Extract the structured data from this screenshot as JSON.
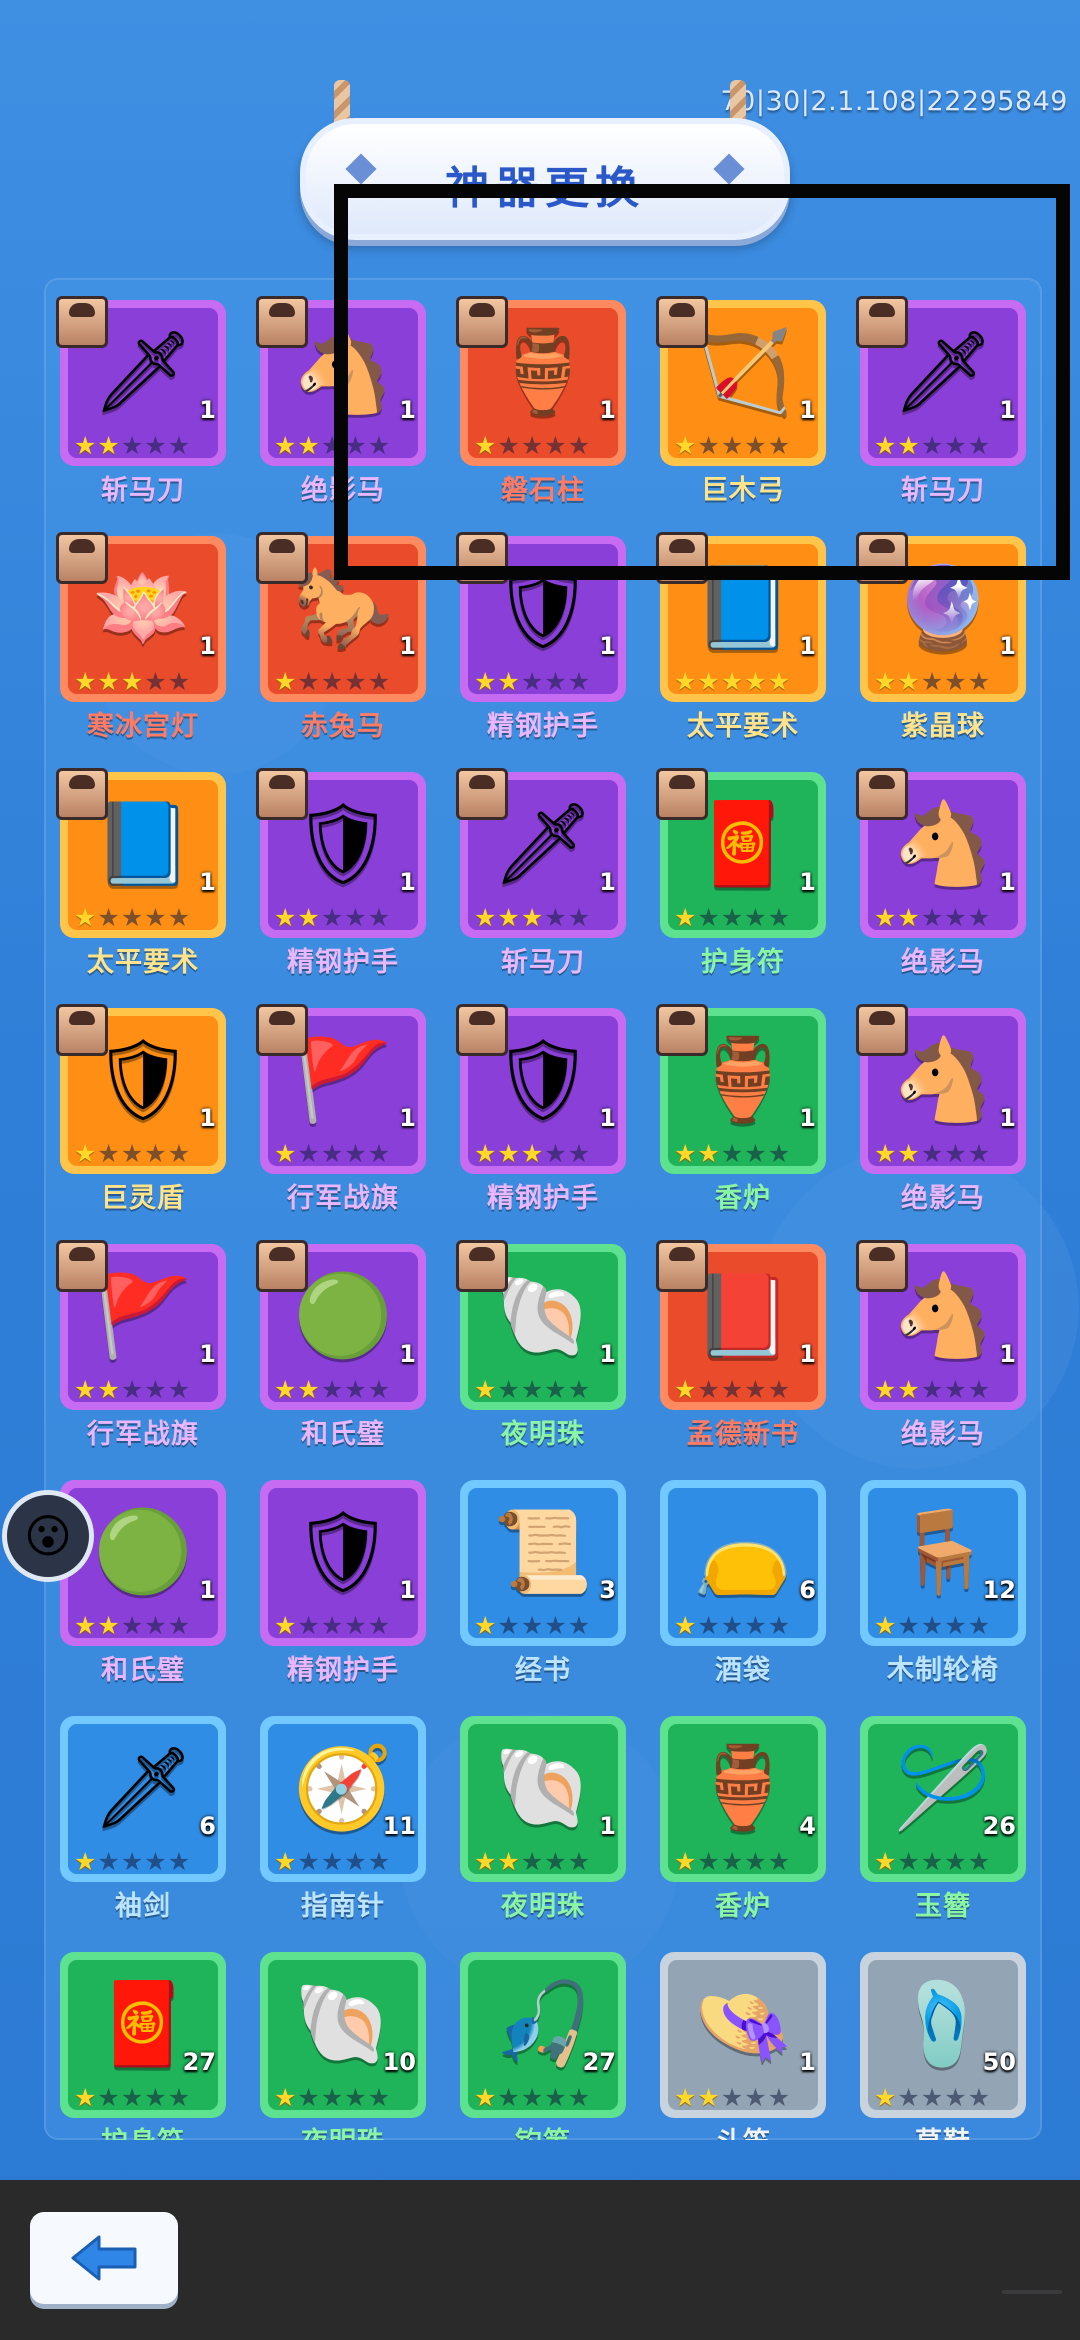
{
  "header": {
    "title": "神器更换",
    "version": "70|30|2.1.108|22295849"
  },
  "colors": {
    "purple": "#8a3fd9",
    "orange": "#ff8f14",
    "red": "#ea4b2b",
    "green": "#1fb45a",
    "blue": "#2f8de6",
    "gray": "#93a5b5",
    "star_on": "#ffd82a"
  },
  "items": [
    {
      "name": "斩马刀",
      "rarity": "purple",
      "stars": 2,
      "count": "1",
      "icon": "blade-icon",
      "glyph": "🗡",
      "portrait": true
    },
    {
      "name": "绝影马",
      "rarity": "purple",
      "stars": 2,
      "count": "1",
      "icon": "horse-armor-icon",
      "glyph": "🐴",
      "portrait": true
    },
    {
      "name": "磐石柱",
      "rarity": "red",
      "stars": 1,
      "count": "1",
      "icon": "stone-pillar-icon",
      "glyph": "🏺",
      "portrait": true
    },
    {
      "name": "巨木弓",
      "rarity": "orange",
      "stars": 1,
      "count": "1",
      "icon": "bow-icon",
      "glyph": "🏹",
      "portrait": true
    },
    {
      "name": "斩马刀",
      "rarity": "purple",
      "stars": 2,
      "count": "1",
      "icon": "blade-icon",
      "glyph": "🗡",
      "portrait": true
    },
    {
      "name": "寒冰宫灯",
      "rarity": "red",
      "stars": 3,
      "count": "1",
      "icon": "lotus-lamp-icon",
      "glyph": "🪷",
      "portrait": true
    },
    {
      "name": "赤兔马",
      "rarity": "red",
      "stars": 1,
      "count": "1",
      "icon": "red-horse-icon",
      "glyph": "🐎",
      "portrait": true
    },
    {
      "name": "精钢护手",
      "rarity": "purple",
      "stars": 2,
      "count": "1",
      "icon": "gauntlet-icon",
      "glyph": "🛡",
      "portrait": true
    },
    {
      "name": "太平要术",
      "rarity": "orange",
      "stars": 5,
      "count": "1",
      "icon": "book-icon",
      "glyph": "📘",
      "portrait": true
    },
    {
      "name": "紫晶球",
      "rarity": "orange",
      "stars": 2,
      "count": "1",
      "icon": "crystal-ball-icon",
      "glyph": "🔮",
      "portrait": true
    },
    {
      "name": "太平要术",
      "rarity": "orange",
      "stars": 1,
      "count": "1",
      "icon": "book-icon",
      "glyph": "📘",
      "portrait": true
    },
    {
      "name": "精钢护手",
      "rarity": "purple",
      "stars": 2,
      "count": "1",
      "icon": "gauntlet-icon",
      "glyph": "🛡",
      "portrait": true
    },
    {
      "name": "斩马刀",
      "rarity": "purple",
      "stars": 3,
      "count": "1",
      "icon": "blade-icon",
      "glyph": "🗡",
      "portrait": true
    },
    {
      "name": "护身符",
      "rarity": "green",
      "stars": 1,
      "count": "1",
      "icon": "amulet-icon",
      "glyph": "🧧",
      "portrait": true
    },
    {
      "name": "绝影马",
      "rarity": "purple",
      "stars": 2,
      "count": "1",
      "icon": "horse-armor-icon",
      "glyph": "🐴",
      "portrait": true
    },
    {
      "name": "巨灵盾",
      "rarity": "orange",
      "stars": 1,
      "count": "1",
      "icon": "shield-icon",
      "glyph": "🛡",
      "portrait": true
    },
    {
      "name": "行军战旗",
      "rarity": "purple",
      "stars": 1,
      "count": "1",
      "icon": "war-banner-icon",
      "glyph": "🚩",
      "portrait": true
    },
    {
      "name": "精钢护手",
      "rarity": "purple",
      "stars": 3,
      "count": "1",
      "icon": "gauntlet-icon",
      "glyph": "🛡",
      "portrait": true
    },
    {
      "name": "香炉",
      "rarity": "green",
      "stars": 2,
      "count": "1",
      "icon": "incense-burner-icon",
      "glyph": "🏺",
      "portrait": true
    },
    {
      "name": "绝影马",
      "rarity": "purple",
      "stars": 2,
      "count": "1",
      "icon": "horse-armor-icon",
      "glyph": "🐴",
      "portrait": true
    },
    {
      "name": "行军战旗",
      "rarity": "purple",
      "stars": 2,
      "count": "1",
      "icon": "war-banner-icon",
      "glyph": "🚩",
      "portrait": true
    },
    {
      "name": "和氏璧",
      "rarity": "purple",
      "stars": 2,
      "count": "1",
      "icon": "jade-disc-icon",
      "glyph": "🟢",
      "portrait": true
    },
    {
      "name": "夜明珠",
      "rarity": "green",
      "stars": 1,
      "count": "1",
      "icon": "pearl-shell-icon",
      "glyph": "🐚",
      "portrait": true
    },
    {
      "name": "孟德新书",
      "rarity": "red",
      "stars": 1,
      "count": "1",
      "icon": "military-book-icon",
      "glyph": "📕",
      "portrait": true
    },
    {
      "name": "绝影马",
      "rarity": "purple",
      "stars": 2,
      "count": "1",
      "icon": "horse-armor-icon",
      "glyph": "🐴",
      "portrait": true
    },
    {
      "name": "和氏璧",
      "rarity": "purple",
      "stars": 2,
      "count": "1",
      "icon": "jade-disc-icon",
      "glyph": "🟢",
      "portrait": false
    },
    {
      "name": "精钢护手",
      "rarity": "purple",
      "stars": 1,
      "count": "1",
      "icon": "gauntlet-icon",
      "glyph": "🛡",
      "portrait": false
    },
    {
      "name": "经书",
      "rarity": "blue",
      "stars": 1,
      "count": "3",
      "icon": "scroll-icon",
      "glyph": "📜",
      "portrait": false
    },
    {
      "name": "酒袋",
      "rarity": "blue",
      "stars": 1,
      "count": "6",
      "icon": "wine-bag-icon",
      "glyph": "👝",
      "portrait": false
    },
    {
      "name": "木制轮椅",
      "rarity": "blue",
      "stars": 1,
      "count": "12",
      "icon": "wooden-wheelchair-icon",
      "glyph": "🪑",
      "portrait": false
    },
    {
      "name": "袖剑",
      "rarity": "blue",
      "stars": 1,
      "count": "6",
      "icon": "sleeve-sword-icon",
      "glyph": "🗡",
      "portrait": false
    },
    {
      "name": "指南针",
      "rarity": "blue",
      "stars": 1,
      "count": "11",
      "icon": "compass-map-icon",
      "glyph": "🧭",
      "portrait": false
    },
    {
      "name": "夜明珠",
      "rarity": "green",
      "stars": 2,
      "count": "1",
      "icon": "pearl-shell-icon",
      "glyph": "🐚",
      "portrait": false
    },
    {
      "name": "香炉",
      "rarity": "green",
      "stars": 1,
      "count": "4",
      "icon": "incense-burner-icon",
      "glyph": "🏺",
      "portrait": false
    },
    {
      "name": "玉簪",
      "rarity": "green",
      "stars": 1,
      "count": "26",
      "icon": "jade-hairpin-icon",
      "glyph": "🪡",
      "portrait": false
    },
    {
      "name": "护身符",
      "rarity": "green",
      "stars": 1,
      "count": "27",
      "icon": "amulet-icon",
      "glyph": "🧧",
      "portrait": false
    },
    {
      "name": "夜明珠",
      "rarity": "green",
      "stars": 1,
      "count": "10",
      "icon": "pearl-shell-icon",
      "glyph": "🐚",
      "portrait": false
    },
    {
      "name": "钓竿",
      "rarity": "green",
      "stars": 1,
      "count": "27",
      "icon": "fishing-rod-icon",
      "glyph": "🎣",
      "portrait": false
    },
    {
      "name": "斗笠",
      "rarity": "gray",
      "stars": 2,
      "count": "1",
      "icon": "straw-hat-icon",
      "glyph": "👒",
      "portrait": false
    },
    {
      "name": "草鞋",
      "rarity": "gray",
      "stars": 1,
      "count": "50",
      "icon": "straw-sandal-icon",
      "glyph": "🩴",
      "portrait": false
    }
  ],
  "footer": {
    "back_icon": "back-arrow-icon"
  }
}
